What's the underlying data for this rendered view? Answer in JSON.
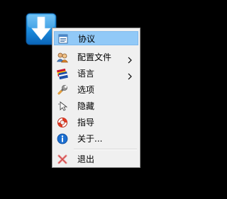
{
  "app": {
    "icon": "download-arrow-icon",
    "accent": "#1d8fe0"
  },
  "menu": {
    "highlight_color": "#91c9f7",
    "items": [
      {
        "label": "协议",
        "icon": "agreement-document-icon",
        "submenu": false,
        "highlighted": true
      },
      {
        "label": "配置文件",
        "icon": "profile-users-icon",
        "submenu": true,
        "highlighted": false
      },
      {
        "label": "语言",
        "icon": "language-flag-icon",
        "submenu": true,
        "highlighted": false
      },
      {
        "label": "选项",
        "icon": "wrench-icon",
        "submenu": false,
        "highlighted": false
      },
      {
        "label": "隐藏",
        "icon": "hide-cursor-icon",
        "submenu": false,
        "highlighted": false
      },
      {
        "label": "指导",
        "icon": "lifebuoy-icon",
        "submenu": false,
        "highlighted": false
      },
      {
        "label": "关于...",
        "icon": "info-icon",
        "submenu": false,
        "highlighted": false
      },
      {
        "label": "退出",
        "icon": "exit-x-icon",
        "submenu": false,
        "highlighted": false
      }
    ]
  }
}
